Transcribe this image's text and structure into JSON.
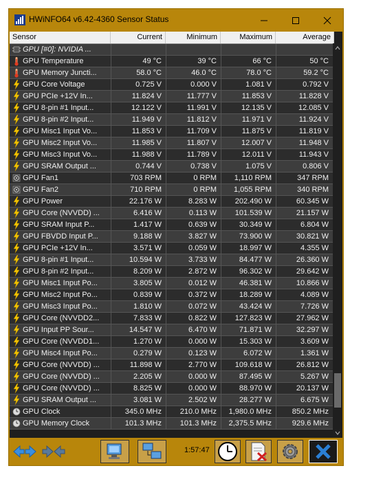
{
  "window": {
    "title": "HWiNFO64 v6.42-4360 Sensor Status"
  },
  "columns": {
    "sensor": "Sensor",
    "current": "Current",
    "minimum": "Minimum",
    "maximum": "Maximum",
    "average": "Average"
  },
  "rows": [
    {
      "icon": "gpu-chip-icon",
      "name": "GPU [#0]: NVIDIA ...",
      "cur": "",
      "min": "",
      "max": "",
      "avg": "",
      "group": true
    },
    {
      "icon": "thermometer-icon",
      "name": "GPU Temperature",
      "cur": "49 °C",
      "min": "39 °C",
      "max": "66 °C",
      "avg": "50 °C"
    },
    {
      "icon": "thermometer-icon",
      "name": "GPU Memory Juncti...",
      "cur": "58.0 °C",
      "min": "46.0 °C",
      "max": "78.0 °C",
      "avg": "59.2 °C"
    },
    {
      "icon": "lightning-icon",
      "name": "GPU Core Voltage",
      "cur": "0.725 V",
      "min": "0.000 V",
      "max": "1.081 V",
      "avg": "0.792 V"
    },
    {
      "icon": "lightning-icon",
      "name": "GPU PCIe +12V In...",
      "cur": "11.824 V",
      "min": "11.777 V",
      "max": "11.853 V",
      "avg": "11.828 V"
    },
    {
      "icon": "lightning-icon",
      "name": "GPU 8-pin #1 Input...",
      "cur": "12.122 V",
      "min": "11.991 V",
      "max": "12.135 V",
      "avg": "12.085 V"
    },
    {
      "icon": "lightning-icon",
      "name": "GPU 8-pin #2 Input...",
      "cur": "11.949 V",
      "min": "11.812 V",
      "max": "11.971 V",
      "avg": "11.924 V"
    },
    {
      "icon": "lightning-icon",
      "name": "GPU Misc1 Input Vo...",
      "cur": "11.853 V",
      "min": "11.709 V",
      "max": "11.875 V",
      "avg": "11.819 V"
    },
    {
      "icon": "lightning-icon",
      "name": "GPU Misc2 Input Vo...",
      "cur": "11.985 V",
      "min": "11.807 V",
      "max": "12.007 V",
      "avg": "11.948 V"
    },
    {
      "icon": "lightning-icon",
      "name": "GPU Misc3 Input Vo...",
      "cur": "11.988 V",
      "min": "11.789 V",
      "max": "12.011 V",
      "avg": "11.943 V"
    },
    {
      "icon": "lightning-icon",
      "name": "GPU SRAM Output ...",
      "cur": "0.744 V",
      "min": "0.738 V",
      "max": "1.075 V",
      "avg": "0.806 V"
    },
    {
      "icon": "fan-icon",
      "name": "GPU Fan1",
      "cur": "703 RPM",
      "min": "0 RPM",
      "max": "1,110 RPM",
      "avg": "347 RPM"
    },
    {
      "icon": "fan-icon",
      "name": "GPU Fan2",
      "cur": "710 RPM",
      "min": "0 RPM",
      "max": "1,055 RPM",
      "avg": "340 RPM"
    },
    {
      "icon": "lightning-icon",
      "name": "GPU Power",
      "cur": "22.176 W",
      "min": "8.283 W",
      "max": "202.490 W",
      "avg": "60.345 W"
    },
    {
      "icon": "lightning-icon",
      "name": "GPU Core (NVVDD) ...",
      "cur": "6.416 W",
      "min": "0.113 W",
      "max": "101.539 W",
      "avg": "21.157 W"
    },
    {
      "icon": "lightning-icon",
      "name": "GPU SRAM Input P...",
      "cur": "1.417 W",
      "min": "0.639 W",
      "max": "30.349 W",
      "avg": "6.804 W"
    },
    {
      "icon": "lightning-icon",
      "name": "GPU FBVDD Input P...",
      "cur": "9.188 W",
      "min": "3.827 W",
      "max": "73.900 W",
      "avg": "30.821 W"
    },
    {
      "icon": "lightning-icon",
      "name": "GPU PCIe +12V In...",
      "cur": "3.571 W",
      "min": "0.059 W",
      "max": "18.997 W",
      "avg": "4.355 W"
    },
    {
      "icon": "lightning-icon",
      "name": "GPU 8-pin #1 Input...",
      "cur": "10.594 W",
      "min": "3.733 W",
      "max": "84.477 W",
      "avg": "26.360 W"
    },
    {
      "icon": "lightning-icon",
      "name": "GPU 8-pin #2 Input...",
      "cur": "8.209 W",
      "min": "2.872 W",
      "max": "96.302 W",
      "avg": "29.642 W"
    },
    {
      "icon": "lightning-icon",
      "name": "GPU Misc1 Input Po...",
      "cur": "3.805 W",
      "min": "0.012 W",
      "max": "46.381 W",
      "avg": "10.866 W"
    },
    {
      "icon": "lightning-icon",
      "name": "GPU Misc2 Input Po...",
      "cur": "0.839 W",
      "min": "0.372 W",
      "max": "18.289 W",
      "avg": "4.089 W"
    },
    {
      "icon": "lightning-icon",
      "name": "GPU Misc3 Input Po...",
      "cur": "1.810 W",
      "min": "0.072 W",
      "max": "43.424 W",
      "avg": "7.726 W"
    },
    {
      "icon": "lightning-icon",
      "name": "GPU Core (NVVDD2...",
      "cur": "7.833 W",
      "min": "0.822 W",
      "max": "127.823 W",
      "avg": "27.962 W"
    },
    {
      "icon": "lightning-icon",
      "name": "GPU Input PP Sour...",
      "cur": "14.547 W",
      "min": "6.470 W",
      "max": "71.871 W",
      "avg": "32.297 W"
    },
    {
      "icon": "lightning-icon",
      "name": "GPU Core (NVVDD1...",
      "cur": "1.270 W",
      "min": "0.000 W",
      "max": "15.303 W",
      "avg": "3.609 W"
    },
    {
      "icon": "lightning-icon",
      "name": "GPU Misc4 Input Po...",
      "cur": "0.279 W",
      "min": "0.123 W",
      "max": "6.072 W",
      "avg": "1.361 W"
    },
    {
      "icon": "lightning-icon",
      "name": "GPU Core (NVVDD) ...",
      "cur": "11.898 W",
      "min": "2.770 W",
      "max": "109.618 W",
      "avg": "26.812 W"
    },
    {
      "icon": "lightning-icon",
      "name": "GPU Core (NVVDD) ...",
      "cur": "2.205 W",
      "min": "0.000 W",
      "max": "87.495 W",
      "avg": "5.267 W"
    },
    {
      "icon": "lightning-icon",
      "name": "GPU Core (NVVDD) ...",
      "cur": "8.825 W",
      "min": "0.000 W",
      "max": "88.970 W",
      "avg": "20.137 W"
    },
    {
      "icon": "lightning-icon",
      "name": "GPU SRAM Output ...",
      "cur": "3.081 W",
      "min": "2.502 W",
      "max": "28.277 W",
      "avg": "6.675 W"
    },
    {
      "icon": "clock-icon",
      "name": "GPU Clock",
      "cur": "345.0 MHz",
      "min": "210.0 MHz",
      "max": "1,980.0 MHz",
      "avg": "850.2 MHz"
    },
    {
      "icon": "clock-icon",
      "name": "GPU Memory Clock",
      "cur": "101.3 MHz",
      "min": "101.3 MHz",
      "max": "2,375.5 MHz",
      "avg": "929.6 MHz"
    }
  ],
  "toolbar": {
    "timer": "1:57:47"
  },
  "colors": {
    "frame": "#b8860b",
    "table_bg": "#2c2c2c",
    "table_alt": "#3d3d3d",
    "text": "#f0f0f0",
    "close_accent": "#2a7fd4"
  }
}
